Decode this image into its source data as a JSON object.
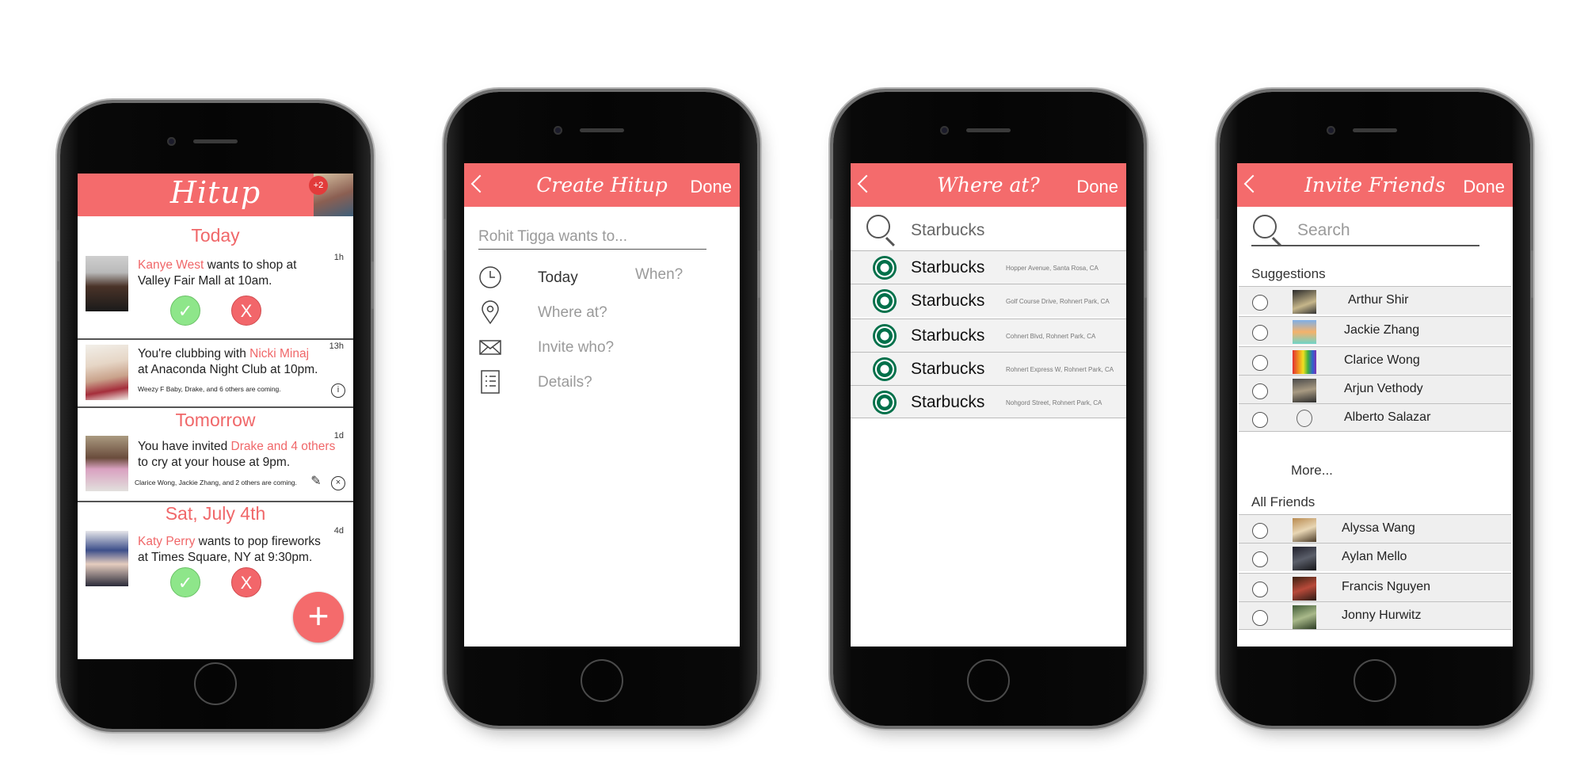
{
  "colors": {
    "accent": "#f46b6c",
    "accept": "#8ee68a",
    "decline": "#f2666a"
  },
  "feed": {
    "app_title": "Hitup",
    "notif_badge": "+2",
    "sections": {
      "today": "Today",
      "tomorrow": "Tomorrow",
      "sat": "Sat, July 4th"
    },
    "cards": [
      {
        "person": "Kanye West",
        "text_a": " wants to shop at",
        "text_b": "Valley Fair Mall at 10am.",
        "age": "1h",
        "accept": "✓",
        "decline": "X"
      },
      {
        "text_pre": "You're clubbing with ",
        "person": "Nicki Minaj",
        "text_b": "at Anaconda Night Club at 10pm.",
        "note": "Weezy F Baby, Drake, and 6 others are coming.",
        "age": "13h"
      },
      {
        "text_pre": "You have invited ",
        "person": "Drake and 4 others",
        "text_b": "to cry at your house at 9pm.",
        "note": "Clarice Wong, Jackie Zhang, and 2 others are coming.",
        "age": "1d"
      },
      {
        "person": "Katy Perry",
        "text_a": " wants to pop fireworks",
        "text_b": "at Times Square, NY at 9:30pm.",
        "age": "4d",
        "accept": "✓",
        "decline": "X"
      }
    ],
    "fab": "+"
  },
  "create": {
    "title": "Create Hitup",
    "done": "Done",
    "placeholder": "Rohit Tigga wants to...",
    "today": "Today",
    "when": "When?",
    "where": "Where at?",
    "invite": "Invite who?",
    "details": "Details?"
  },
  "where": {
    "title": "Where at?",
    "done": "Done",
    "search_value": "Starbucks",
    "results": [
      {
        "name": "Starbucks",
        "address": "Hopper Avenue, Santa Rosa, CA"
      },
      {
        "name": "Starbucks",
        "address": "Golf Course Drive, Rohnert Park, CA"
      },
      {
        "name": "Starbucks",
        "address": "Cohnert Blvd, Rohnert Park, CA"
      },
      {
        "name": "Starbucks",
        "address": "Rohnert Express W, Rohnert Park, CA"
      },
      {
        "name": "Starbucks",
        "address": "Nohgord Street, Rohnert Park, CA"
      }
    ]
  },
  "invite": {
    "title": "Invite Friends",
    "done": "Done",
    "search_placeholder": "Search",
    "suggestions_label": "Suggestions",
    "suggestions": [
      "Arthur Shir",
      "Jackie Zhang",
      "Clarice Wong",
      "Arjun Vethody",
      "Alberto Salazar"
    ],
    "more": "More...",
    "all_label": "All Friends",
    "all": [
      "Alyssa Wang",
      "Aylan Mello",
      "Francis Nguyen",
      "Jonny Hurwitz"
    ]
  }
}
